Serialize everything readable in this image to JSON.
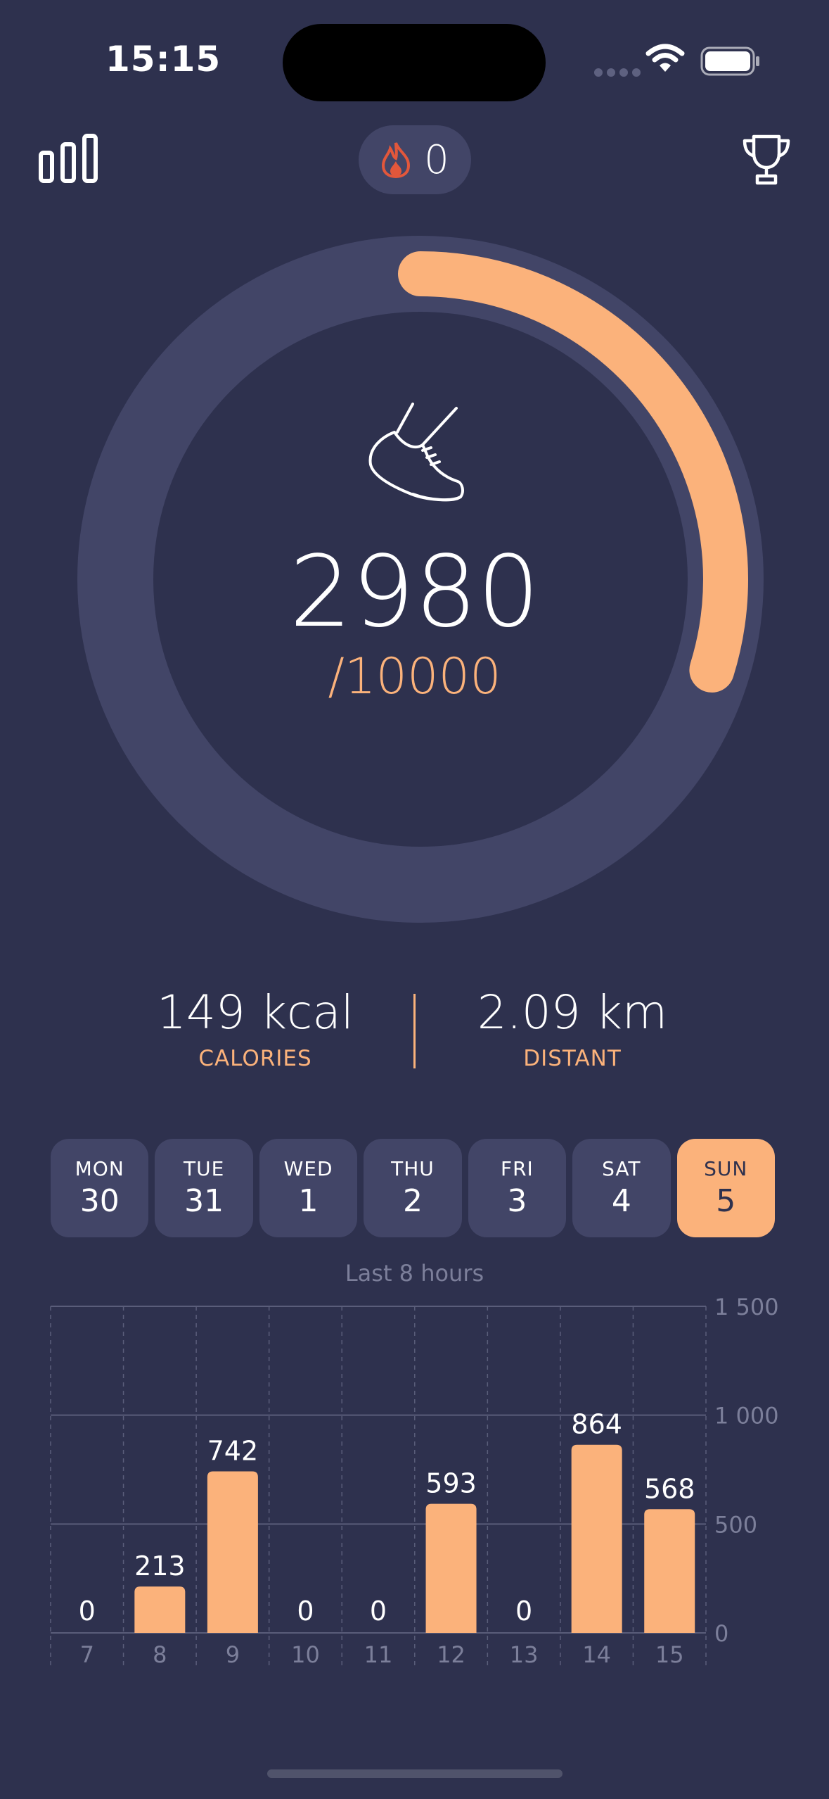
{
  "status_bar": {
    "time": "15:15"
  },
  "header": {
    "streak_count": "0"
  },
  "progress": {
    "steps": "2980",
    "goal_label": "/10000",
    "fraction": 0.298
  },
  "metrics": {
    "calories_value": "149 kcal",
    "calories_label": "CALORIES",
    "distance_value": "2.09 km",
    "distance_label": "DISTANT"
  },
  "days": [
    {
      "name": "MON",
      "num": "30",
      "active": false
    },
    {
      "name": "TUE",
      "num": "31",
      "active": false
    },
    {
      "name": "WED",
      "num": "1",
      "active": false
    },
    {
      "name": "THU",
      "num": "2",
      "active": false
    },
    {
      "name": "FRI",
      "num": "3",
      "active": false
    },
    {
      "name": "SAT",
      "num": "4",
      "active": false
    },
    {
      "name": "SUN",
      "num": "5",
      "active": true
    }
  ],
  "chart_caption": "Last 8 hours",
  "chart_data": {
    "type": "bar",
    "title": "",
    "categories": [
      "7",
      "8",
      "9",
      "10",
      "11",
      "12",
      "13",
      "14",
      "15"
    ],
    "values": [
      0,
      213,
      742,
      0,
      0,
      593,
      0,
      864,
      568
    ],
    "y_ticks": [
      "0",
      "500",
      "1 000",
      "1 500"
    ],
    "ylim": [
      0,
      1500
    ],
    "grid": true,
    "bar_color": "#fbb27b"
  },
  "colors": {
    "background": "#2e314e",
    "ring_track": "#424567",
    "accent": "#fbb27b"
  }
}
